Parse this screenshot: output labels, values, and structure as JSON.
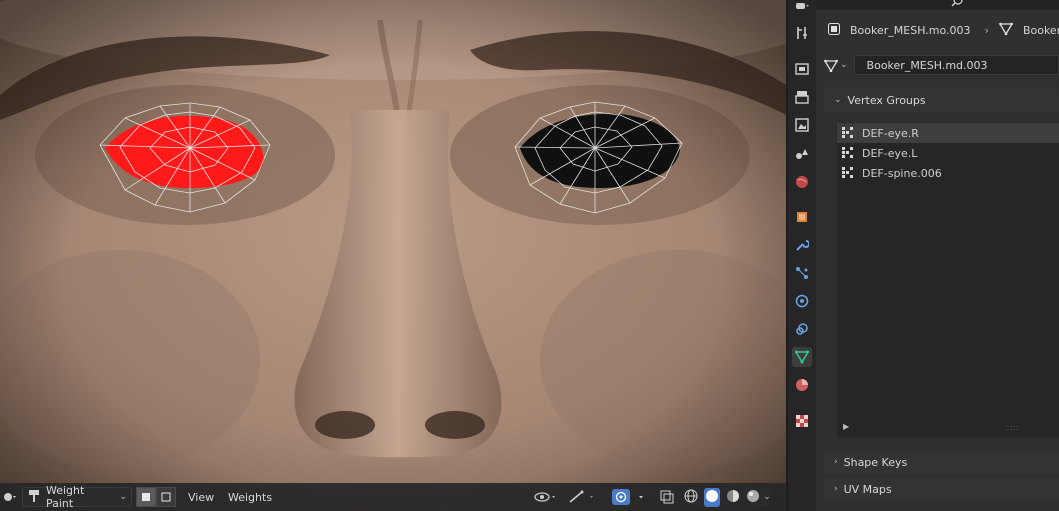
{
  "viewport": {
    "mode_label": "Weight Paint",
    "menus": {
      "view": "View",
      "weights": "Weights"
    }
  },
  "properties": {
    "object_name": "Booker_MESH.mo.003",
    "object_name_cut": "Booker_",
    "mesh_name": "Booker_MESH.md.003",
    "vertex_groups": {
      "title": "Vertex Groups",
      "items": [
        {
          "label": "DEF-eye.R",
          "selected": true
        },
        {
          "label": "DEF-eye.L",
          "selected": false
        },
        {
          "label": "DEF-spine.006",
          "selected": false
        }
      ]
    },
    "shape_keys_title": "Shape Keys",
    "uv_maps_title": "UV Maps"
  },
  "colors": {
    "weight_active": "#ff1a1a",
    "weight_zero": "#101010",
    "active_tab": "#2ecc8a"
  },
  "tabs": [
    "tool-icon",
    "render-icon",
    "output-icon",
    "view-layer-icon",
    "scene-icon",
    "world-icon",
    "object-icon",
    "modifier-icon",
    "particles-icon",
    "physics-icon",
    "constraints-icon",
    "data-icon",
    "material-icon",
    "texture-icon"
  ]
}
